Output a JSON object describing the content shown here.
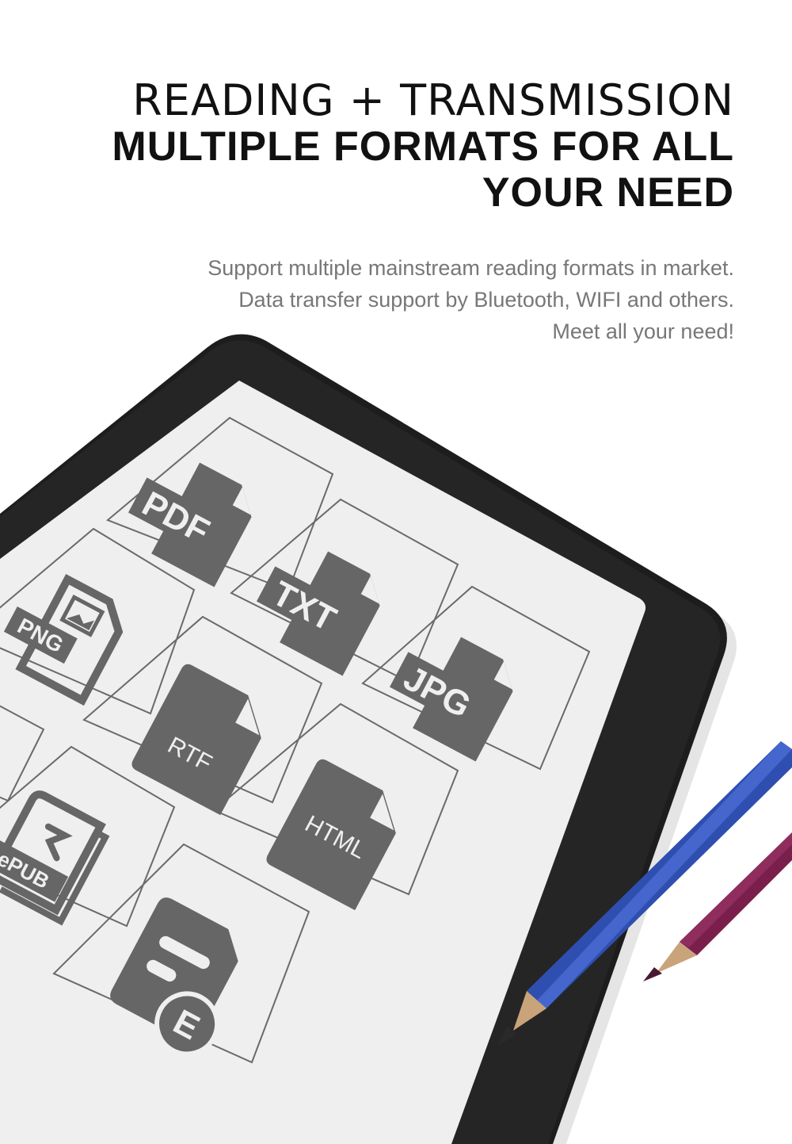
{
  "header": {
    "line1": "READING + TRANSMISSION",
    "line2": "MULTIPLE FORMATS FOR ALL",
    "line3": "YOUR NEED"
  },
  "description": {
    "line1": "Support multiple mainstream reading formats in market.",
    "line2": "Data transfer support by Bluetooth, WIFI and others.",
    "line3": "Meet all your need!"
  },
  "formats": {
    "pdf": "PDF",
    "txt": "TXT",
    "png": "PNG",
    "jpg": "JPG",
    "rtf": "RTF",
    "html": "HTML",
    "epub": "ePUB",
    "mobi_badge": "E"
  },
  "colors": {
    "device": "#1d1d1d",
    "screen": "#efefef",
    "icon": "#666666",
    "pencil_blue": "#2f4fb0",
    "pencil_purple": "#7a1f4c"
  }
}
